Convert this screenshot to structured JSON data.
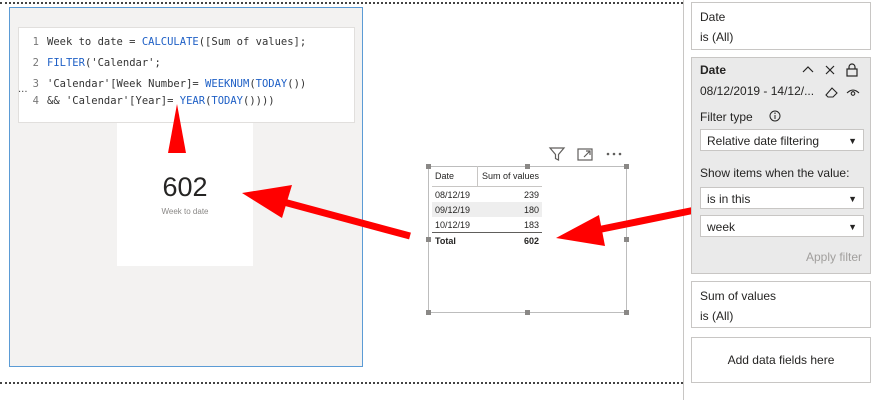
{
  "card": {
    "value": "602",
    "label": "Week to date"
  },
  "dax": {
    "lines": [
      {
        "num": "1",
        "tokens": [
          {
            "t": "Week to date = ",
            "c": "txt"
          },
          {
            "t": "CALCULATE",
            "c": "fn"
          },
          {
            "t": "([Sum of values];",
            "c": "txt"
          }
        ]
      },
      {
        "num": "2",
        "tokens": [
          {
            "t": "FILTER",
            "c": "fn"
          },
          {
            "t": "('Calendar';",
            "c": "txt"
          }
        ]
      },
      {
        "num": "3",
        "tokens": [
          {
            "t": "'Calendar'[Week Number]= ",
            "c": "txt"
          },
          {
            "t": "WEEKNUM",
            "c": "fn"
          },
          {
            "t": "(",
            "c": "txt"
          },
          {
            "t": "TODAY",
            "c": "fn"
          },
          {
            "t": "())",
            "c": "txt"
          }
        ]
      },
      {
        "num": "4",
        "tokens": [
          {
            "t": "&& 'Calendar'[Year]= ",
            "c": "txt"
          },
          {
            "t": "YEAR",
            "c": "fn"
          },
          {
            "t": "(",
            "c": "txt"
          },
          {
            "t": "TODAY",
            "c": "fn"
          },
          {
            "t": "())))",
            "c": "txt"
          }
        ]
      }
    ],
    "ellipsis": "..."
  },
  "table": {
    "headers": [
      "Date",
      "Sum of values"
    ],
    "rows": [
      [
        "08/12/19",
        "239"
      ],
      [
        "09/12/19",
        "180"
      ],
      [
        "10/12/19",
        "183"
      ]
    ],
    "total": [
      "Total",
      "602"
    ]
  },
  "filters": {
    "date_top": {
      "title": "Date",
      "value": "is (All)"
    },
    "date_active": {
      "title": "Date",
      "range": "08/12/2019 - 14/12/...",
      "filter_type_label": "Filter type",
      "filter_type": "Relative date filtering",
      "show_items_label": "Show items when the value:",
      "condition": "is in this",
      "unit": "week",
      "apply": "Apply filter"
    },
    "sum_values": {
      "title": "Sum of values",
      "value": "is (All)"
    },
    "add_fields": "Add data fields here"
  },
  "colors": {
    "arrow": "#ff0000",
    "selection_border": "#5b9bd5",
    "function_token": "#1f60c6"
  },
  "icons": [
    "filter-icon",
    "focus-mode-icon",
    "more-options-icon",
    "chevron-up-icon",
    "close-icon",
    "lock-icon",
    "eraser-icon",
    "eye-icon",
    "info-icon"
  ]
}
